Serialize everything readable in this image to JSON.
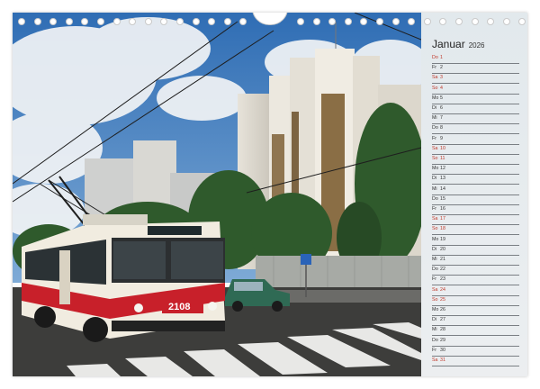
{
  "calendar": {
    "month": "Januar",
    "year": "2026",
    "days": [
      {
        "wd": "Do",
        "d": "1",
        "we": true
      },
      {
        "wd": "Fr",
        "d": "2",
        "we": false
      },
      {
        "wd": "Sa",
        "d": "3",
        "we": true
      },
      {
        "wd": "So",
        "d": "4",
        "we": true
      },
      {
        "wd": "Mo",
        "d": "5",
        "we": false
      },
      {
        "wd": "Di",
        "d": "6",
        "we": false
      },
      {
        "wd": "Mi",
        "d": "7",
        "we": false
      },
      {
        "wd": "Do",
        "d": "8",
        "we": false
      },
      {
        "wd": "Fr",
        "d": "9",
        "we": false
      },
      {
        "wd": "Sa",
        "d": "10",
        "we": true
      },
      {
        "wd": "So",
        "d": "11",
        "we": true
      },
      {
        "wd": "Mo",
        "d": "12",
        "we": false
      },
      {
        "wd": "Di",
        "d": "13",
        "we": false
      },
      {
        "wd": "Mi",
        "d": "14",
        "we": false
      },
      {
        "wd": "Do",
        "d": "15",
        "we": false
      },
      {
        "wd": "Fr",
        "d": "16",
        "we": false
      },
      {
        "wd": "Sa",
        "d": "17",
        "we": true
      },
      {
        "wd": "So",
        "d": "18",
        "we": true
      },
      {
        "wd": "Mo",
        "d": "19",
        "we": false
      },
      {
        "wd": "Di",
        "d": "20",
        "we": false
      },
      {
        "wd": "Mi",
        "d": "21",
        "we": false
      },
      {
        "wd": "Do",
        "d": "22",
        "we": false
      },
      {
        "wd": "Fr",
        "d": "23",
        "we": false
      },
      {
        "wd": "Sa",
        "d": "24",
        "we": true
      },
      {
        "wd": "So",
        "d": "25",
        "we": true
      },
      {
        "wd": "Mo",
        "d": "26",
        "we": false
      },
      {
        "wd": "Di",
        "d": "27",
        "we": false
      },
      {
        "wd": "Mi",
        "d": "28",
        "we": false
      },
      {
        "wd": "Do",
        "d": "29",
        "we": false
      },
      {
        "wd": "Fr",
        "d": "30",
        "we": false
      },
      {
        "wd": "Sa",
        "d": "31",
        "we": true
      }
    ]
  },
  "photo": {
    "trolleybus_number": "2108"
  },
  "colors": {
    "weekend": "#c0392b",
    "weekday": "#333333",
    "bus_red": "#c8202a",
    "sky": "#3b7dc4"
  }
}
